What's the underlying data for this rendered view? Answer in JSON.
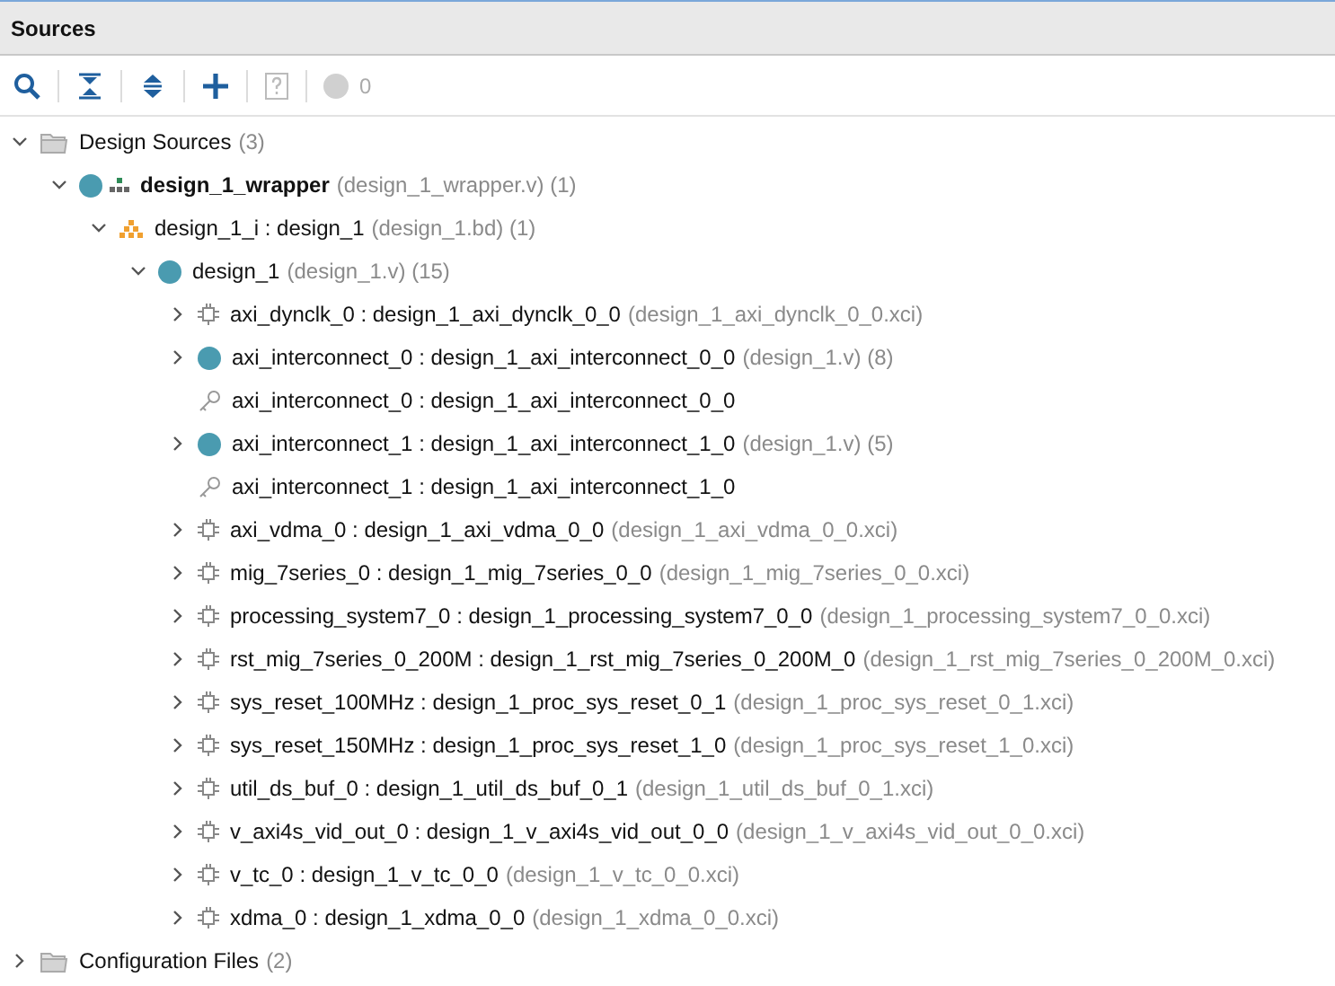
{
  "panel": {
    "title": "Sources"
  },
  "toolbar": {
    "help_disabled": true,
    "messages": {
      "count": "0",
      "disabled": true
    }
  },
  "tree": [
    {
      "kind": "folder",
      "name": "Design Sources",
      "detail": "(3)",
      "expanded": true,
      "children": [
        {
          "kind": "wrapper",
          "name": "design_1_wrapper",
          "bold": true,
          "detail": "(design_1_wrapper.v) (1)",
          "expanded": true,
          "children": [
            {
              "kind": "block-design",
              "name": "design_1_i : design_1",
              "detail": "(design_1.bd) (1)",
              "expanded": true,
              "children": [
                {
                  "kind": "module",
                  "name": "design_1",
                  "detail": "(design_1.v) (15)",
                  "expanded": true,
                  "children": [
                    {
                      "kind": "ip",
                      "name": "axi_dynclk_0 : design_1_axi_dynclk_0_0",
                      "detail": "(design_1_axi_dynclk_0_0.xci)",
                      "expanded": false
                    },
                    {
                      "kind": "module",
                      "name": "axi_interconnect_0 : design_1_axi_interconnect_0_0",
                      "detail": "(design_1.v) (8)",
                      "expanded": false
                    },
                    {
                      "kind": "key",
                      "name": "axi_interconnect_0 : design_1_axi_interconnect_0_0"
                    },
                    {
                      "kind": "module",
                      "name": "axi_interconnect_1 : design_1_axi_interconnect_1_0",
                      "detail": "(design_1.v) (5)",
                      "expanded": false
                    },
                    {
                      "kind": "key",
                      "name": "axi_interconnect_1 : design_1_axi_interconnect_1_0"
                    },
                    {
                      "kind": "ip",
                      "name": "axi_vdma_0 : design_1_axi_vdma_0_0",
                      "detail": "(design_1_axi_vdma_0_0.xci)",
                      "expanded": false
                    },
                    {
                      "kind": "ip",
                      "name": "mig_7series_0 : design_1_mig_7series_0_0",
                      "detail": "(design_1_mig_7series_0_0.xci)",
                      "expanded": false
                    },
                    {
                      "kind": "ip",
                      "name": "processing_system7_0 : design_1_processing_system7_0_0",
                      "detail": "(design_1_processing_system7_0_0.xci)",
                      "expanded": false
                    },
                    {
                      "kind": "ip",
                      "name": "rst_mig_7series_0_200M : design_1_rst_mig_7series_0_200M_0",
                      "detail": "(design_1_rst_mig_7series_0_200M_0.xci)",
                      "expanded": false
                    },
                    {
                      "kind": "ip",
                      "name": "sys_reset_100MHz : design_1_proc_sys_reset_0_1",
                      "detail": "(design_1_proc_sys_reset_0_1.xci)",
                      "expanded": false
                    },
                    {
                      "kind": "ip",
                      "name": "sys_reset_150MHz : design_1_proc_sys_reset_1_0",
                      "detail": "(design_1_proc_sys_reset_1_0.xci)",
                      "expanded": false
                    },
                    {
                      "kind": "ip",
                      "name": "util_ds_buf_0 : design_1_util_ds_buf_0_1",
                      "detail": "(design_1_util_ds_buf_0_1.xci)",
                      "expanded": false
                    },
                    {
                      "kind": "ip",
                      "name": "v_axi4s_vid_out_0 : design_1_v_axi4s_vid_out_0_0",
                      "detail": "(design_1_v_axi4s_vid_out_0_0.xci)",
                      "expanded": false
                    },
                    {
                      "kind": "ip",
                      "name": "v_tc_0 : design_1_v_tc_0_0",
                      "detail": "(design_1_v_tc_0_0.xci)",
                      "expanded": false
                    },
                    {
                      "kind": "ip",
                      "name": "xdma_0 : design_1_xdma_0_0",
                      "detail": "(design_1_xdma_0_0.xci)",
                      "expanded": false
                    }
                  ]
                }
              ]
            }
          ]
        }
      ]
    },
    {
      "kind": "folder",
      "name": "Configuration Files",
      "detail": "(2)",
      "expanded": false
    }
  ]
}
